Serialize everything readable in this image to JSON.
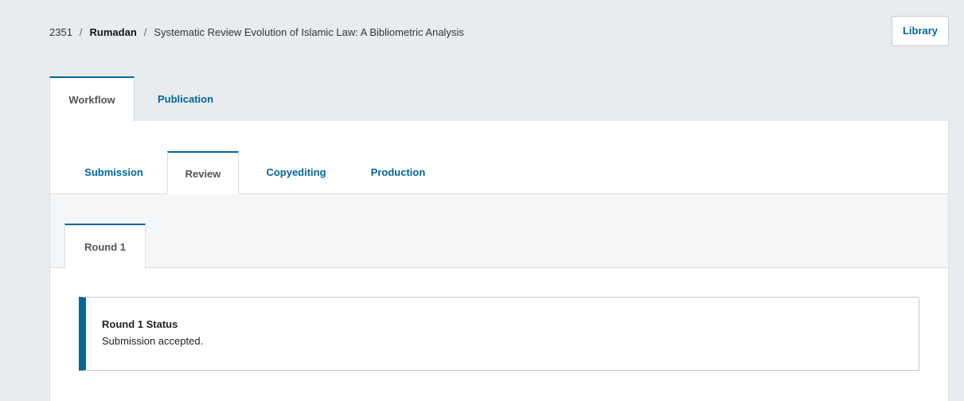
{
  "header": {
    "breadcrumb": {
      "id": "2351",
      "separator": "/",
      "author": "Rumadan",
      "title": "Systematic Review Evolution of Islamic Law: A Bibliometric Analysis"
    },
    "library_label": "Library"
  },
  "tabs": [
    {
      "label": "Workflow",
      "active": true
    },
    {
      "label": "Publication",
      "active": false
    }
  ],
  "stage_tabs": [
    {
      "label": "Submission",
      "active": false
    },
    {
      "label": "Review",
      "active": true
    },
    {
      "label": "Copyediting",
      "active": false
    },
    {
      "label": "Production",
      "active": false
    }
  ],
  "round_tabs": [
    {
      "label": "Round 1",
      "active": true
    }
  ],
  "status": {
    "title": "Round 1 Status",
    "message": "Submission accepted."
  },
  "colors": {
    "accent": "#006798",
    "background": "#e9ecee",
    "border": "#dddddd"
  }
}
